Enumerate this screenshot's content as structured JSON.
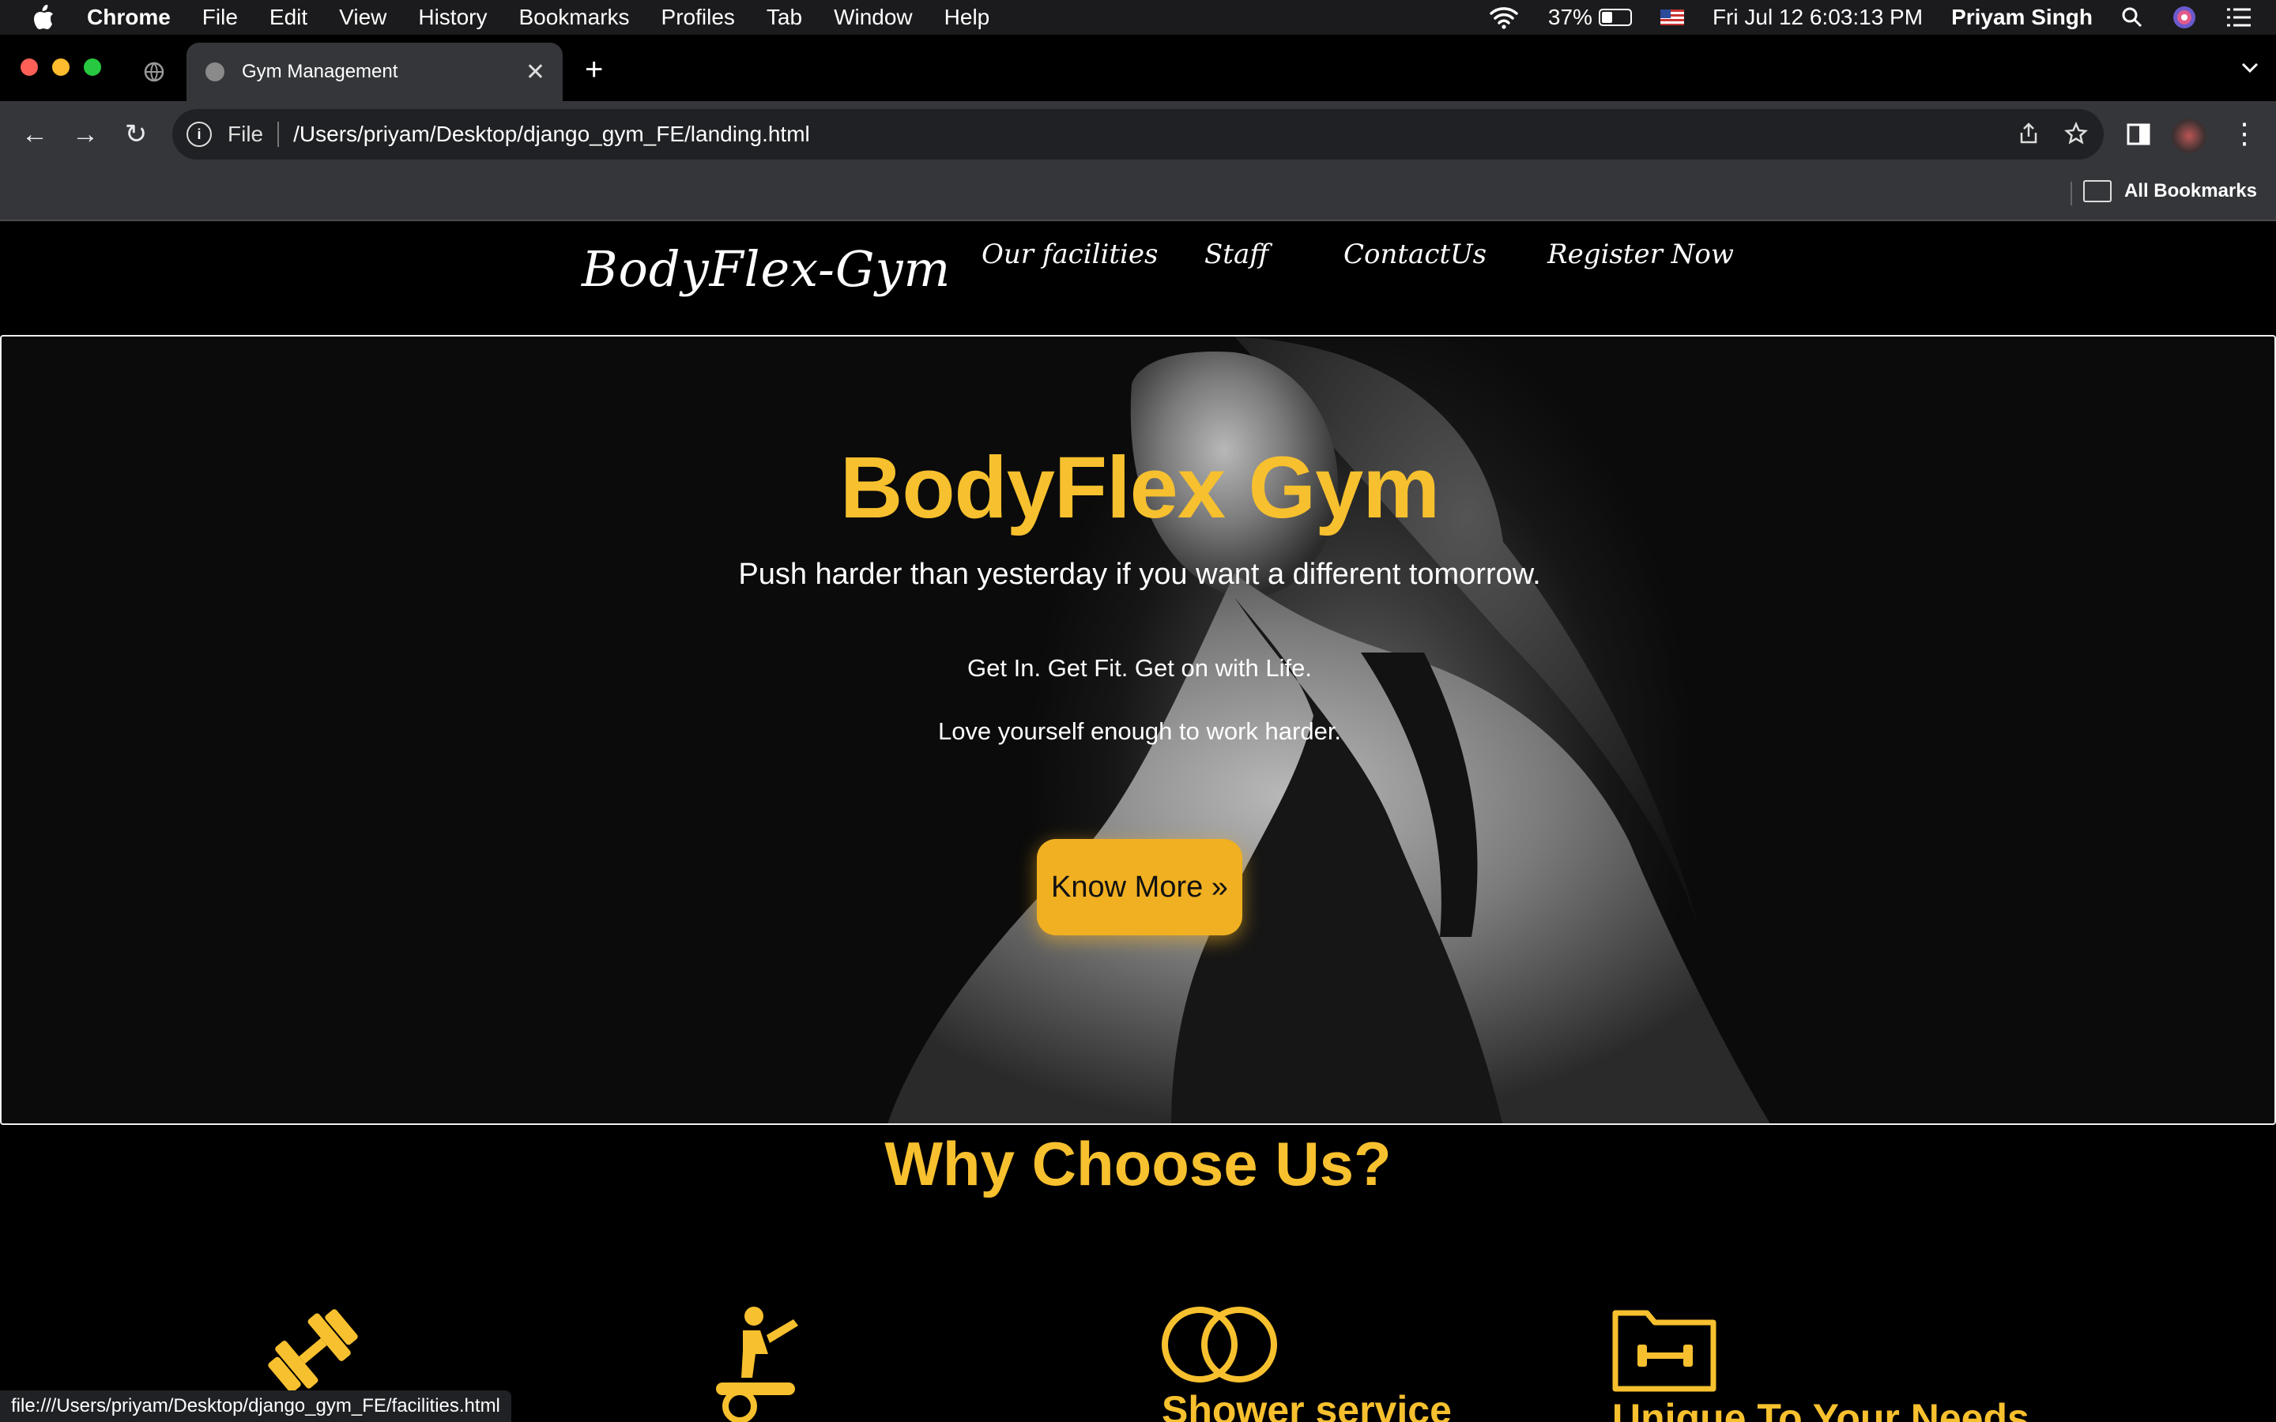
{
  "menubar": {
    "app": "Chrome",
    "items": [
      "File",
      "Edit",
      "View",
      "History",
      "Bookmarks",
      "Profiles",
      "Tab",
      "Window",
      "Help"
    ],
    "battery": "37%",
    "battery_level": 0.37,
    "datetime": "Fri Jul 12  6:03:13 PM",
    "user": "Priyam Singh"
  },
  "browser": {
    "tab_title": "Gym Management",
    "url_scheme": "File",
    "url": "/Users/priyam/Desktop/django_gym_FE/landing.html",
    "bookmarks_label": "All Bookmarks",
    "status_url": "file:///Users/priyam/Desktop/django_gym_FE/facilities.html"
  },
  "site": {
    "logo": "BodyFlex-Gym",
    "nav": [
      "Our facilities",
      "Staff",
      "ContactUs",
      "Register Now"
    ],
    "hero": {
      "title": "BodyFlex Gym",
      "subtitle": "Push harder than yesterday if you want a different tomorrow.",
      "line1": "Get In. Get Fit. Get on with Life.",
      "line2": "Love yourself enough to work harder.",
      "button": "Know More »"
    },
    "why_title": "Why Choose Us?",
    "features": [
      {
        "icon": "dumbbell-icon",
        "label": ""
      },
      {
        "icon": "elliptical-machine-icon",
        "label": ""
      },
      {
        "icon": "rings-icon",
        "label": "Shower service"
      },
      {
        "icon": "folder-dumbbell-icon",
        "label": "Unique To Your Needs"
      }
    ]
  },
  "colors": {
    "accent": "#f7c02e",
    "button": "#f0b021",
    "menubar": "#1b1b1d",
    "toolbar": "#35363a"
  }
}
